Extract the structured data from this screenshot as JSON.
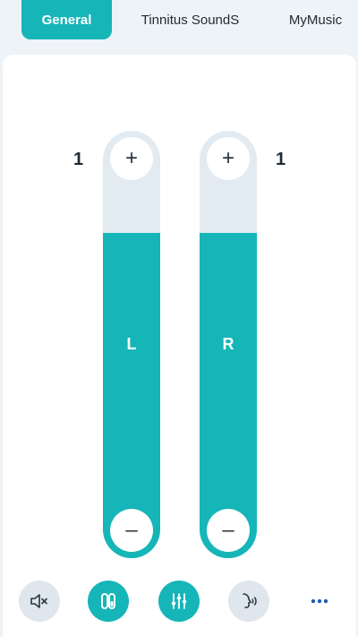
{
  "tabs": [
    {
      "label": "General",
      "active": true
    },
    {
      "label": "Tinnitus SoundS",
      "active": false
    },
    {
      "label": "MyMusic",
      "active": false
    }
  ],
  "left": {
    "level": "1",
    "channel": "L",
    "fill": 0.76
  },
  "right": {
    "level": "1",
    "channel": "R",
    "fill": 0.76
  },
  "controls": {
    "plus": "+",
    "minus": "–"
  },
  "toolbar": [
    {
      "icon": "mute-icon"
    },
    {
      "icon": "earbuds-icon"
    },
    {
      "icon": "equalizer-icon"
    },
    {
      "icon": "voice-icon"
    },
    {
      "icon": "more-icon"
    }
  ],
  "colors": {
    "accent": "#16b5b8",
    "track": "#e3ebf2",
    "background": "#eef3f7"
  }
}
